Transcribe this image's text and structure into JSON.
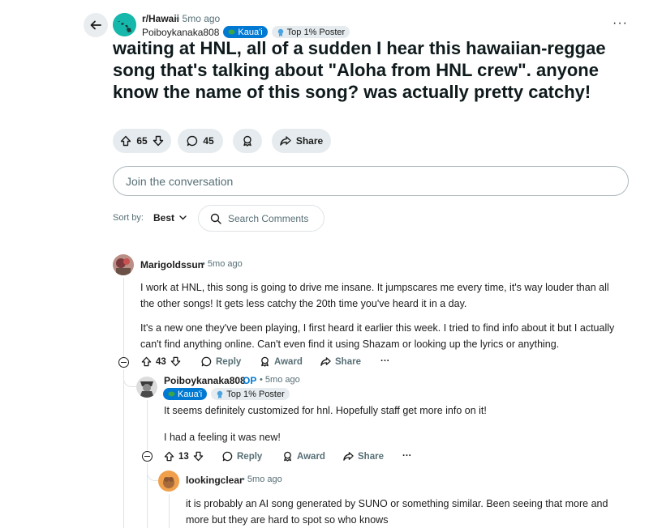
{
  "post": {
    "subreddit": "r/Hawaii",
    "time": "• 5mo ago",
    "author": "Poiboykanaka808",
    "flair_place": "Kaua'i",
    "flair_rank": "Top 1% Poster",
    "title": "waiting at HNL, all of a sudden I hear this hawaiian-reggae song that's talking about \"Aloha from HNL crew\". anyone know the name of this song? was actually pretty catchy!",
    "votes": "65",
    "comments": "45",
    "share_label": "Share"
  },
  "composer": {
    "placeholder": "Join the conversation"
  },
  "sort": {
    "label": "Sort by:",
    "value": "Best",
    "search_placeholder": "Search Comments"
  },
  "comments": [
    {
      "user": "Marigoldssun",
      "time": "• 5mo ago",
      "body": [
        "I work at HNL, this song is going to drive me insane. It jumpscares me every time, it's way louder than all the other songs! It gets less catchy the 20th time you've heard it in a day.",
        "It's a new one they've been playing, I first heard it earlier this week. I tried to find info about it but I actually can't find anything online. Can't even find it using Shazam or looking up the lyrics or anything."
      ],
      "votes": "43",
      "reply": "Reply",
      "award": "Award",
      "share": "Share",
      "more": "···"
    },
    {
      "user": "Poiboykanaka808",
      "op": "OP",
      "time": "• 5mo ago",
      "flair_place": "Kaua'i",
      "flair_rank": "Top 1% Poster",
      "body": [
        "It seems definitely customized for hnl. Hopefully staff get more info on it!",
        "I had a feeling it was new!"
      ],
      "votes": "13",
      "reply": "Reply",
      "award": "Award",
      "share": "Share",
      "more": "···"
    },
    {
      "user": "lookingclear",
      "time": "• 5mo ago",
      "body": [
        "it is probably an AI song generated by SUNO or something similar. Been seeing that more and more but they are hard to spot so who knows"
      ]
    }
  ],
  "colors": {
    "accent": "#0079d3",
    "pill_bg": "#e5ebee",
    "muted_text": "#576f76"
  },
  "icons": [
    "back-arrow-icon",
    "upvote-icon",
    "downvote-icon",
    "comment-icon",
    "award-icon",
    "share-icon",
    "search-icon",
    "chevron-down-icon",
    "more-icon"
  ]
}
